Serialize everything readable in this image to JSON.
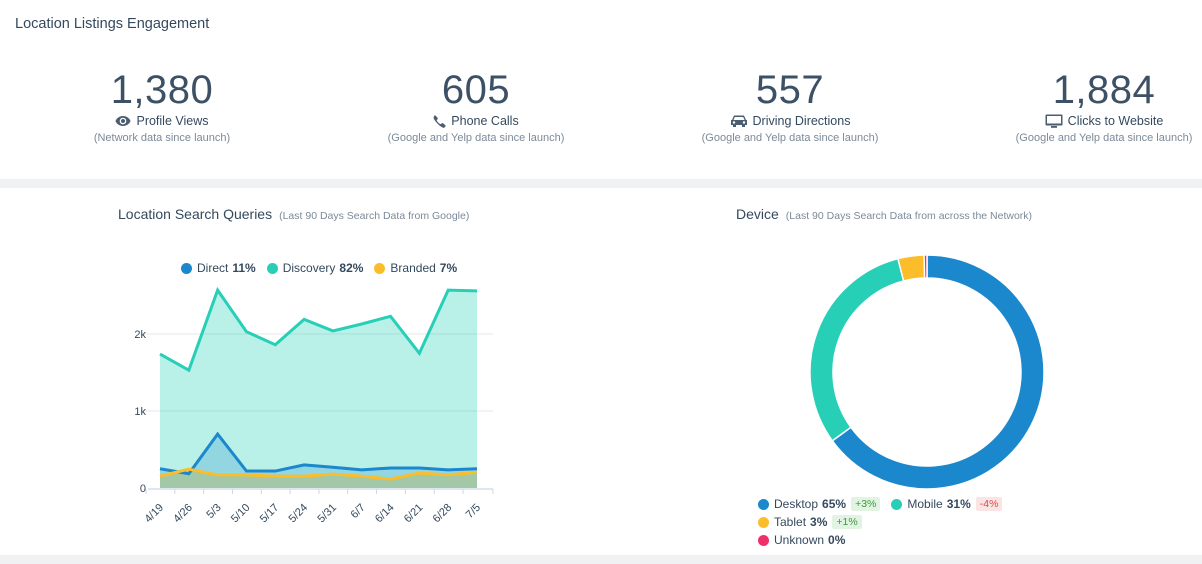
{
  "page_title": "Location Listings Engagement",
  "stats": [
    {
      "value": "1,380",
      "label": "Profile Views",
      "icon": "eye-icon",
      "sub": "(Network data since launch)"
    },
    {
      "value": "605",
      "label": "Phone Calls",
      "icon": "phone-icon",
      "sub": "(Google and Yelp data since launch)"
    },
    {
      "value": "557",
      "label": "Driving Directions",
      "icon": "car-icon",
      "sub": "(Google and Yelp data since launch)"
    },
    {
      "value": "1,884",
      "label": "Clicks to Website",
      "icon": "monitor-icon",
      "sub": "(Google and Yelp data since launch)"
    }
  ],
  "search_queries": {
    "title": "Location Search Queries",
    "subtitle": "(Last 90 Days Search Data from Google)",
    "legend": [
      {
        "name": "Direct",
        "pct": "11%",
        "color": "#1b87cc"
      },
      {
        "name": "Discovery",
        "pct": "82%",
        "color": "#26cfb6"
      },
      {
        "name": "Branded",
        "pct": "7%",
        "color": "#fbbd2a"
      }
    ]
  },
  "device": {
    "title": "Device",
    "subtitle": "(Last 90 Days Search Data from across the Network)",
    "legend": [
      {
        "name": "Desktop",
        "pct": "65%",
        "delta": "+3%",
        "delta_dir": "up",
        "color": "#1b87cc"
      },
      {
        "name": "Mobile",
        "pct": "31%",
        "delta": "-4%",
        "delta_dir": "down",
        "color": "#26cfb6"
      },
      {
        "name": "Tablet",
        "pct": "3%",
        "delta": "+1%",
        "delta_dir": "up",
        "color": "#fbbd2a"
      },
      {
        "name": "Unknown",
        "pct": "0%",
        "delta": "",
        "delta_dir": "",
        "color": "#f0306a"
      }
    ]
  },
  "chart_data": [
    {
      "type": "area",
      "title": "Location Search Queries",
      "subtitle": "(Last 90 Days Search Data from Google)",
      "xlabel": "",
      "ylabel": "",
      "categories": [
        "4/19",
        "4/26",
        "5/3",
        "5/10",
        "5/17",
        "5/24",
        "5/31",
        "6/7",
        "6/14",
        "6/21",
        "6/28",
        "7/5"
      ],
      "yticks": [
        0,
        1000,
        2000
      ],
      "ytick_labels": [
        "0",
        "1k",
        "2k"
      ],
      "ylim": [
        0,
        2700
      ],
      "grid": true,
      "legend_position": "top",
      "series": [
        {
          "name": "Discovery",
          "pct": "82%",
          "color": "#26cfb6",
          "values": [
            1740,
            1530,
            2570,
            2030,
            1860,
            2190,
            2040,
            2130,
            2230,
            1750,
            2570,
            2560
          ]
        },
        {
          "name": "Direct",
          "pct": "11%",
          "color": "#1b87cc",
          "values": [
            250,
            185,
            700,
            220,
            220,
            300,
            270,
            235,
            260,
            260,
            235,
            250
          ]
        },
        {
          "name": "Branded",
          "pct": "7%",
          "color": "#fbbd2a",
          "values": [
            155,
            245,
            170,
            170,
            155,
            155,
            180,
            155,
            115,
            195,
            170,
            205
          ]
        }
      ]
    },
    {
      "type": "pie",
      "donut": true,
      "title": "Device",
      "subtitle": "(Last 90 Days Search Data from across the Network)",
      "legend_position": "bottom",
      "categories": [
        "Desktop",
        "Mobile",
        "Tablet",
        "Unknown"
      ],
      "values": [
        65,
        31,
        3.6,
        0.4
      ],
      "colors": [
        "#1b87cc",
        "#26cfb6",
        "#fbbd2a",
        "#f0306a"
      ],
      "deltas": [
        "+3%",
        "-4%",
        "+1%",
        ""
      ]
    }
  ]
}
